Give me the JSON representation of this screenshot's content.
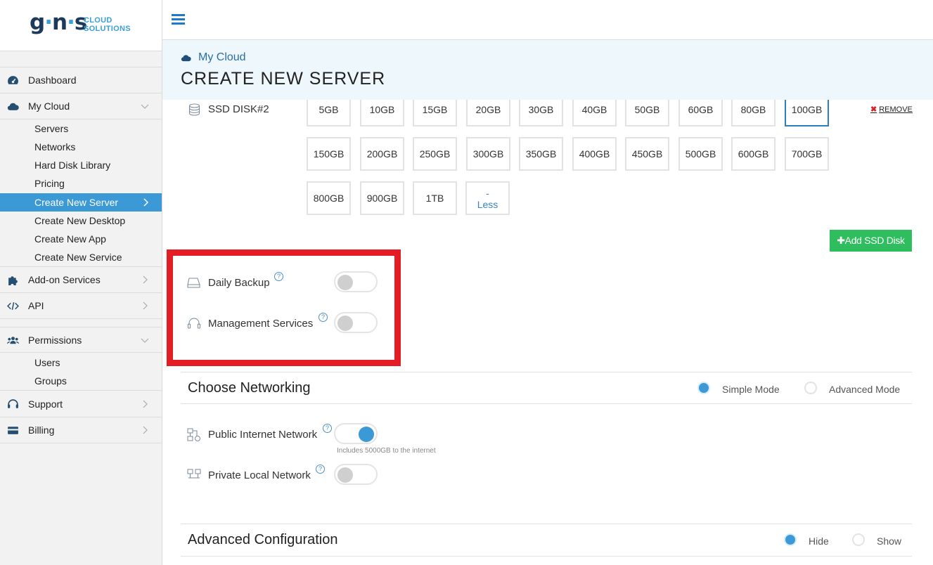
{
  "brand": {
    "logo": "gns",
    "sub_line1": "CLOUD",
    "sub_line2": "SOLUTIONS"
  },
  "sidebar": {
    "items": [
      {
        "label": "Dashboard",
        "icon": "dashboard-icon"
      },
      {
        "label": "My Cloud",
        "icon": "cloud-icon"
      },
      {
        "label": "Add-on Services",
        "icon": "puzzle-icon"
      },
      {
        "label": "API",
        "icon": "code-icon"
      },
      {
        "label": "Permissions",
        "icon": "users-icon"
      },
      {
        "label": "Support",
        "icon": "headset-icon"
      },
      {
        "label": "Billing",
        "icon": "credit-card-icon"
      }
    ],
    "mycloud_sub": [
      "Servers",
      "Networks",
      "Hard Disk Library",
      "Pricing",
      "Create New Server",
      "Create New Desktop",
      "Create New App",
      "Create New Service"
    ],
    "permissions_sub": [
      "Users",
      "Groups"
    ],
    "active_item": "Create New Server"
  },
  "header": {
    "breadcrumb": "My Cloud",
    "title": "CREATE NEW SERVER"
  },
  "disk": {
    "label": "SSD DISK#2",
    "sizes": [
      "5GB",
      "10GB",
      "15GB",
      "20GB",
      "30GB",
      "40GB",
      "50GB",
      "60GB",
      "80GB",
      "100GB",
      "150GB",
      "200GB",
      "250GB",
      "300GB",
      "350GB",
      "400GB",
      "450GB",
      "500GB",
      "600GB",
      "700GB",
      "800GB",
      "900GB",
      "1TB"
    ],
    "selected": "100GB",
    "less_dash": "-",
    "less_label": "Less",
    "remove_label": "REMOVE",
    "remove_icon": "✖",
    "add_label": "Add SSD Disk",
    "add_icon": "✚"
  },
  "options": {
    "daily_backup": {
      "label": "Daily Backup",
      "on": false
    },
    "management": {
      "label": "Management Services",
      "on": false
    },
    "help_glyph": "?"
  },
  "networking": {
    "title": "Choose Networking",
    "modes": [
      "Simple Mode",
      "Advanced Mode"
    ],
    "selected_mode": "Simple Mode",
    "public": {
      "label": "Public Internet Network",
      "on": true,
      "note": "Includes 5000GB to the internet"
    },
    "private": {
      "label": "Private Local Network",
      "on": false
    }
  },
  "advanced": {
    "title": "Advanced Configuration",
    "options": [
      "Hide",
      "Show"
    ],
    "selected": "Hide"
  },
  "colors": {
    "accent": "#3b99d6",
    "add_button": "#2fbe5e",
    "highlight": "#e41c24",
    "selected_border": "#2e7fbf"
  }
}
